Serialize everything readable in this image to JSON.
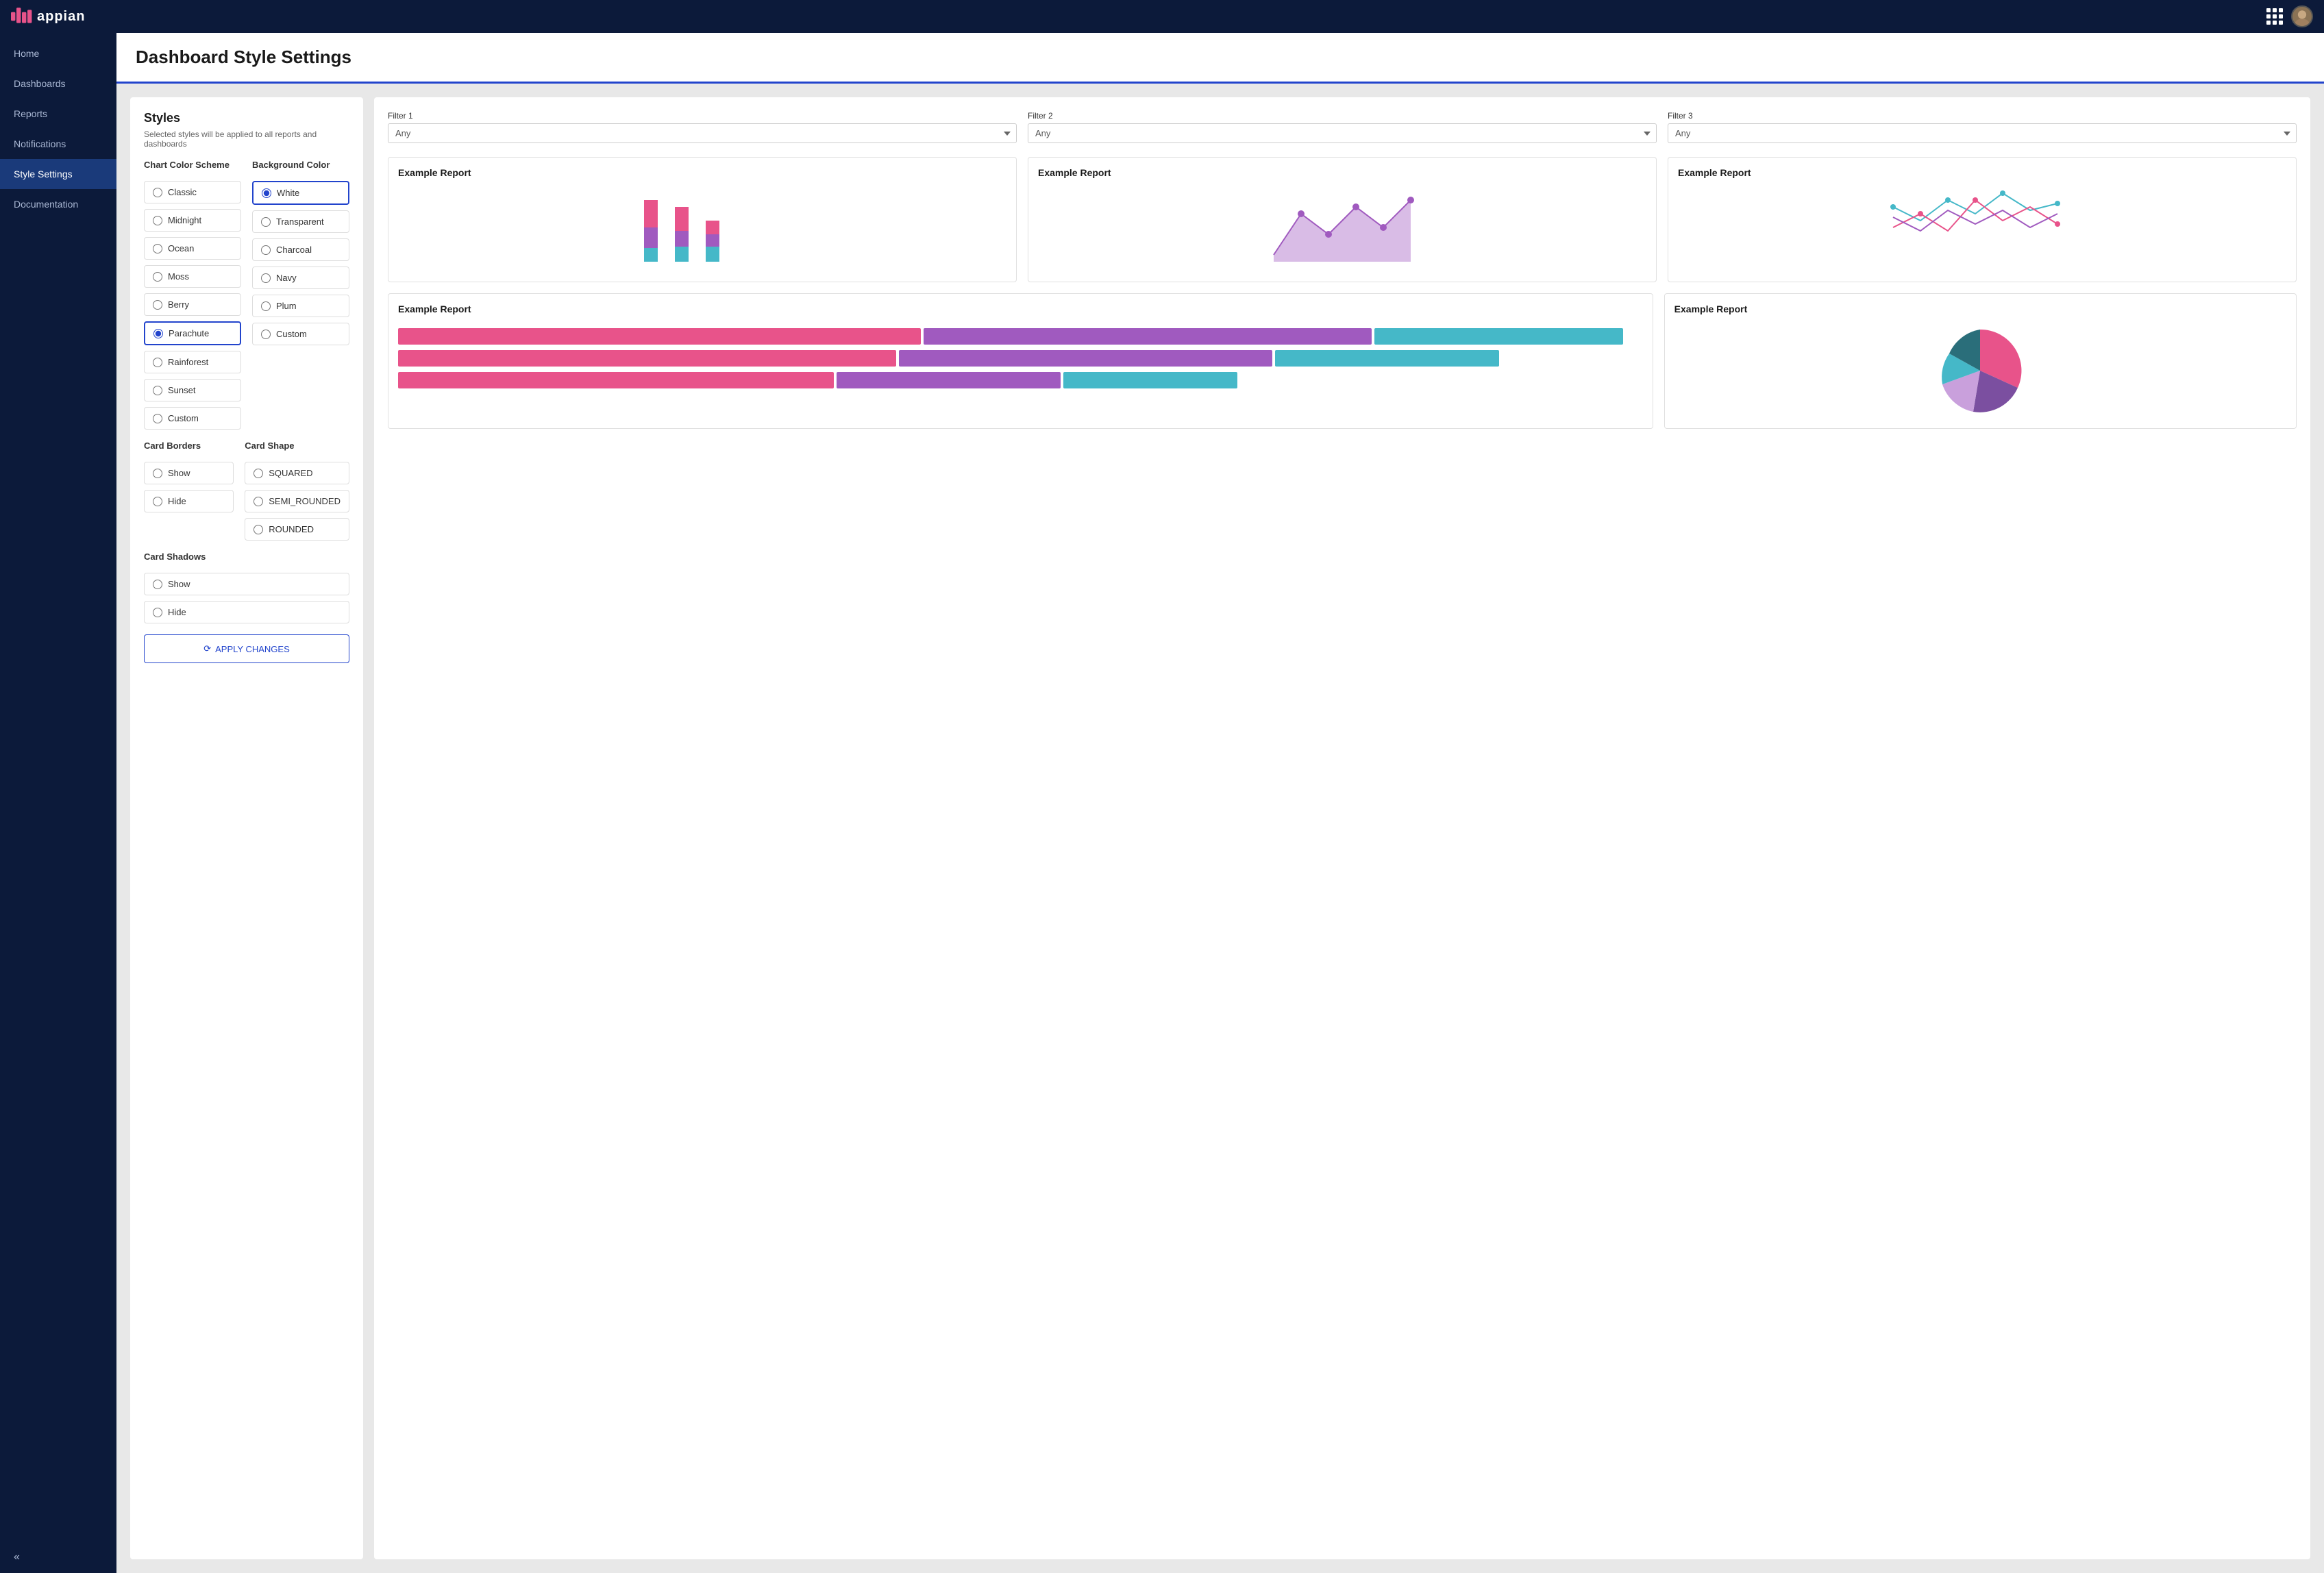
{
  "app": {
    "logo": "appian",
    "title": "Dashboard Style Settings"
  },
  "sidebar": {
    "items": [
      {
        "id": "home",
        "label": "Home",
        "active": false
      },
      {
        "id": "dashboards",
        "label": "Dashboards",
        "active": false
      },
      {
        "id": "reports",
        "label": "Reports",
        "active": false
      },
      {
        "id": "notifications",
        "label": "Notifications",
        "active": false
      },
      {
        "id": "style-settings",
        "label": "Style Settings",
        "active": true
      },
      {
        "id": "documentation",
        "label": "Documentation",
        "active": false
      }
    ],
    "collapse_icon": "«"
  },
  "styles_panel": {
    "title": "Styles",
    "description": "Selected styles will be applied to all reports and dashboards",
    "chart_color_scheme_label": "Chart Color Scheme",
    "background_color_label": "Background Color",
    "color_schemes": [
      {
        "id": "classic",
        "label": "Classic",
        "selected": false
      },
      {
        "id": "midnight",
        "label": "Midnight",
        "selected": false
      },
      {
        "id": "ocean",
        "label": "Ocean",
        "selected": false
      },
      {
        "id": "moss",
        "label": "Moss",
        "selected": false
      },
      {
        "id": "berry",
        "label": "Berry",
        "selected": false
      },
      {
        "id": "parachute",
        "label": "Parachute",
        "selected": true
      },
      {
        "id": "rainforest",
        "label": "Rainforest",
        "selected": false
      },
      {
        "id": "sunset",
        "label": "Sunset",
        "selected": false
      },
      {
        "id": "custom",
        "label": "Custom",
        "selected": false
      }
    ],
    "background_colors": [
      {
        "id": "white",
        "label": "White",
        "selected": true
      },
      {
        "id": "transparent",
        "label": "Transparent",
        "selected": false
      },
      {
        "id": "charcoal",
        "label": "Charcoal",
        "selected": false
      },
      {
        "id": "navy",
        "label": "Navy",
        "selected": false
      },
      {
        "id": "plum",
        "label": "Plum",
        "selected": false
      },
      {
        "id": "custom",
        "label": "Custom",
        "selected": false
      }
    ],
    "card_borders_label": "Card Borders",
    "card_borders": [
      {
        "id": "show",
        "label": "Show",
        "selected": false
      },
      {
        "id": "hide",
        "label": "Hide",
        "selected": false
      }
    ],
    "card_shape_label": "Card Shape",
    "card_shapes": [
      {
        "id": "squared",
        "label": "SQUARED",
        "selected": false
      },
      {
        "id": "semi-rounded",
        "label": "SEMI_ROUNDED",
        "selected": false
      },
      {
        "id": "rounded",
        "label": "ROUNDED",
        "selected": false
      }
    ],
    "card_shadows_label": "Card Shadows",
    "card_shadows": [
      {
        "id": "show",
        "label": "Show",
        "selected": false
      },
      {
        "id": "hide",
        "label": "Hide",
        "selected": false
      }
    ],
    "apply_btn": "APPLY CHANGES"
  },
  "preview": {
    "filters": [
      {
        "id": "filter1",
        "label": "Filter 1",
        "placeholder": "Any"
      },
      {
        "id": "filter2",
        "label": "Filter 2",
        "placeholder": "Any"
      },
      {
        "id": "filter3",
        "label": "Filter 3",
        "placeholder": "Any"
      }
    ],
    "reports": [
      {
        "id": "bar-chart",
        "title": "Example Report",
        "type": "bar"
      },
      {
        "id": "area-chart",
        "title": "Example Report",
        "type": "area"
      },
      {
        "id": "line-chart",
        "title": "Example Report",
        "type": "line"
      },
      {
        "id": "hbar-chart",
        "title": "Example Report",
        "type": "hbar"
      },
      {
        "id": "pie-chart",
        "title": "Example Report",
        "type": "pie"
      }
    ]
  },
  "colors": {
    "pink": "#e8538a",
    "purple": "#a05abf",
    "teal": "#45b8c8",
    "light_purple": "#c9a0dc",
    "dark_purple": "#7b4fa0",
    "sidebar_bg": "#0c1a3a",
    "active_nav": "#1a3a7a",
    "accent": "#2244cc"
  }
}
